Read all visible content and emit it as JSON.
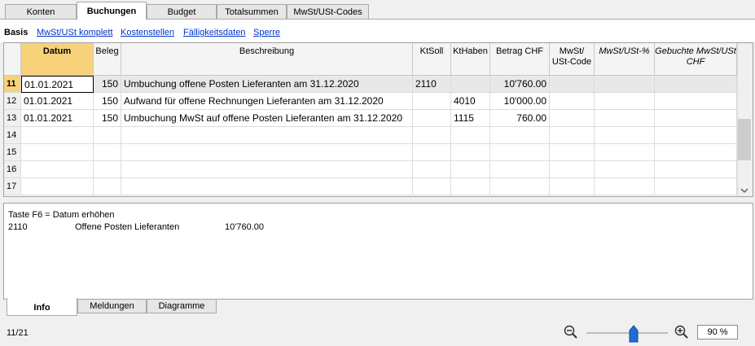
{
  "tabs": [
    {
      "label": "Konten"
    },
    {
      "label": "Buchungen"
    },
    {
      "label": "Budget"
    },
    {
      "label": "Totalsummen"
    },
    {
      "label": "MwSt/USt-Codes"
    }
  ],
  "views": [
    {
      "label": "Basis"
    },
    {
      "label": "MwSt/USt komplett"
    },
    {
      "label": "Kostenstellen"
    },
    {
      "label": "Fälligkeitsdaten"
    },
    {
      "label": "Sperre"
    }
  ],
  "table": {
    "headers": {
      "datum": "Datum",
      "beleg": "Beleg",
      "beschreibung": "Beschreibung",
      "ktsoll": "KtSoll",
      "kthaben": "KtHaben",
      "betrag": "Betrag CHF",
      "mwst_code_1": "MwSt/",
      "mwst_code_2": "USt-Code",
      "mwst_pct": "MwSt/USt-%",
      "gebucht_1": "Gebuchte MwSt/USt",
      "gebucht_2": "CHF"
    },
    "rows": [
      {
        "nr": "11",
        "datum": "01.01.2021",
        "beleg": "150",
        "beschreibung": "Umbuchung offene Posten Lieferanten am 31.12.2020",
        "ktsoll": "2110",
        "kthaben": "",
        "betrag": "10'760.00"
      },
      {
        "nr": "12",
        "datum": "01.01.2021",
        "beleg": "150",
        "beschreibung": "Aufwand für offene Rechnungen Lieferanten am 31.12.2020",
        "ktsoll": "",
        "kthaben": "4010",
        "betrag": "10'000.00"
      },
      {
        "nr": "13",
        "datum": "01.01.2021",
        "beleg": "150",
        "beschreibung": "Umbuchung MwSt auf offene Posten Lieferanten am 31.12.2020",
        "ktsoll": "",
        "kthaben": "1115",
        "betrag": "760.00"
      },
      {
        "nr": "14",
        "datum": "",
        "beleg": "",
        "beschreibung": "",
        "ktsoll": "",
        "kthaben": "",
        "betrag": ""
      },
      {
        "nr": "15",
        "datum": "",
        "beleg": "",
        "beschreibung": "",
        "ktsoll": "",
        "kthaben": "",
        "betrag": ""
      },
      {
        "nr": "16",
        "datum": "",
        "beleg": "",
        "beschreibung": "",
        "ktsoll": "",
        "kthaben": "",
        "betrag": ""
      },
      {
        "nr": "17",
        "datum": "",
        "beleg": "",
        "beschreibung": "",
        "ktsoll": "",
        "kthaben": "",
        "betrag": ""
      }
    ]
  },
  "info": {
    "line1": "Taste F6 = Datum erhöhen",
    "account": "2110",
    "account_name": "Offene Posten Lieferanten",
    "amount": "10'760.00"
  },
  "bottom_tabs": [
    {
      "label": "Info"
    },
    {
      "label": "Meldungen"
    },
    {
      "label": "Diagramme"
    }
  ],
  "status": {
    "position": "11/21",
    "zoom": "90 %",
    "zoom_level_percent": 90
  }
}
